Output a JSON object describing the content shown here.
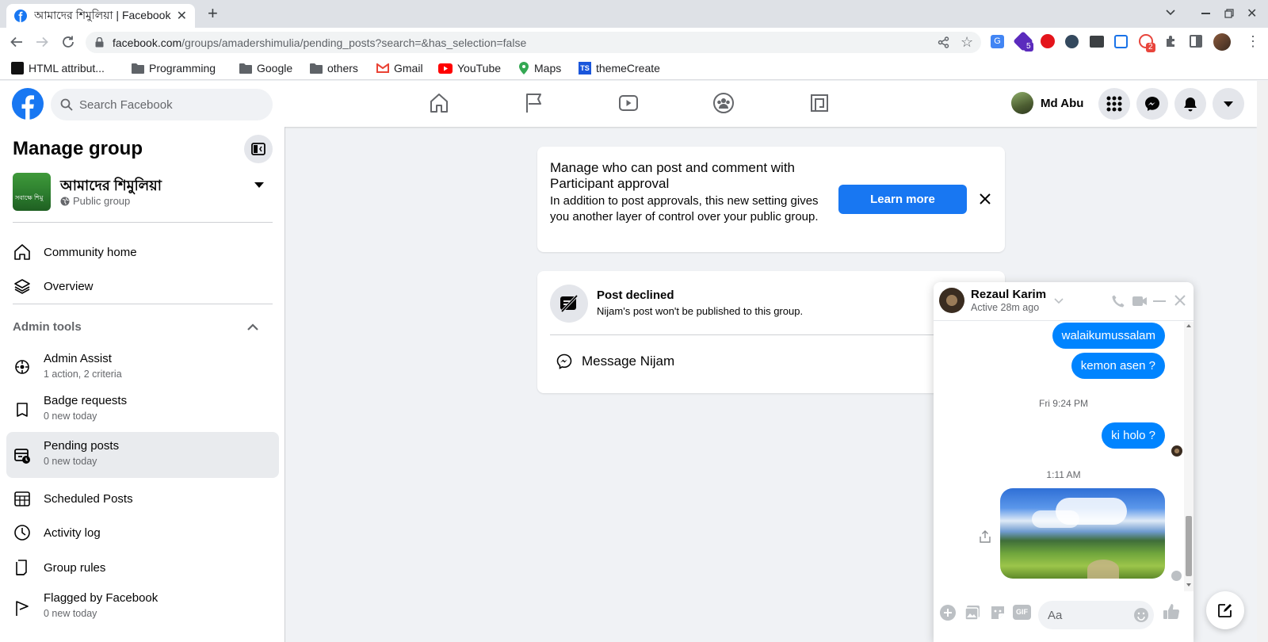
{
  "browser": {
    "tab_title": "আমাদের শিমুলিয়া | Facebook",
    "url_host": "facebook.com",
    "url_path": "/groups/amadershimulia/pending_posts?search=&has_selection=false",
    "extension_badges": [
      "5",
      "2"
    ],
    "bookmarks": [
      {
        "label": "HTML attribut...",
        "icon": "html-icon"
      },
      {
        "label": "Programming",
        "icon": "folder-icon"
      },
      {
        "label": "Google",
        "icon": "folder-icon"
      },
      {
        "label": "others",
        "icon": "folder-icon"
      },
      {
        "label": "Gmail",
        "icon": "gmail-icon"
      },
      {
        "label": "YouTube",
        "icon": "youtube-icon"
      },
      {
        "label": "Maps",
        "icon": "maps-icon"
      },
      {
        "label": "themeCreate",
        "icon": "ts-icon"
      }
    ]
  },
  "header": {
    "search_placeholder": "Search Facebook",
    "profile_name": "Md Abu",
    "brand_color": "#1877f2"
  },
  "sidebar": {
    "title": "Manage group",
    "group_name": "আমাদের শিমুলিয়া",
    "group_thumb_text": "সবাক্ষে শিমু",
    "group_privacy": "Public group",
    "nav": [
      {
        "label": "Community home",
        "icon": "home-icon"
      },
      {
        "label": "Overview",
        "icon": "layers-icon"
      }
    ],
    "admin_tools_label": "Admin tools",
    "admin_items": [
      {
        "label": "Admin Assist",
        "sub": "1 action, 2 criteria",
        "icon": "admin-assist-icon"
      },
      {
        "label": "Badge requests",
        "sub": "0 new today",
        "icon": "badge-icon"
      },
      {
        "label": "Pending posts",
        "sub": "0 new today",
        "icon": "pending-posts-icon",
        "selected": true
      },
      {
        "label": "Scheduled Posts",
        "sub": "",
        "icon": "calendar-icon"
      },
      {
        "label": "Activity log",
        "sub": "",
        "icon": "clock-icon"
      },
      {
        "label": "Group rules",
        "sub": "",
        "icon": "rules-icon"
      },
      {
        "label": "Flagged by Facebook",
        "sub": "0 new today",
        "icon": "flag-icon"
      }
    ]
  },
  "banner": {
    "title": "Manage who can post and comment with Participant approval",
    "body": "In addition to post approvals, this new setting gives you another layer of control over your public group.",
    "button": "Learn more"
  },
  "post_declined": {
    "title": "Post declined",
    "body": "Nijam's post won't be published to this group.",
    "message_label": "Message Nijam"
  },
  "chat": {
    "name": "Rezaul Karim",
    "status": "Active 28m ago",
    "messages": [
      {
        "text": "walaikumussalam"
      },
      {
        "text": "kemon asen ?"
      },
      {
        "time": "Fri 9:24 PM"
      },
      {
        "text": "ki holo ?"
      },
      {
        "time": "1:11 AM"
      },
      {
        "image": "landscape-photo"
      }
    ],
    "input_placeholder": "Aa",
    "gif_label": "GIF"
  }
}
